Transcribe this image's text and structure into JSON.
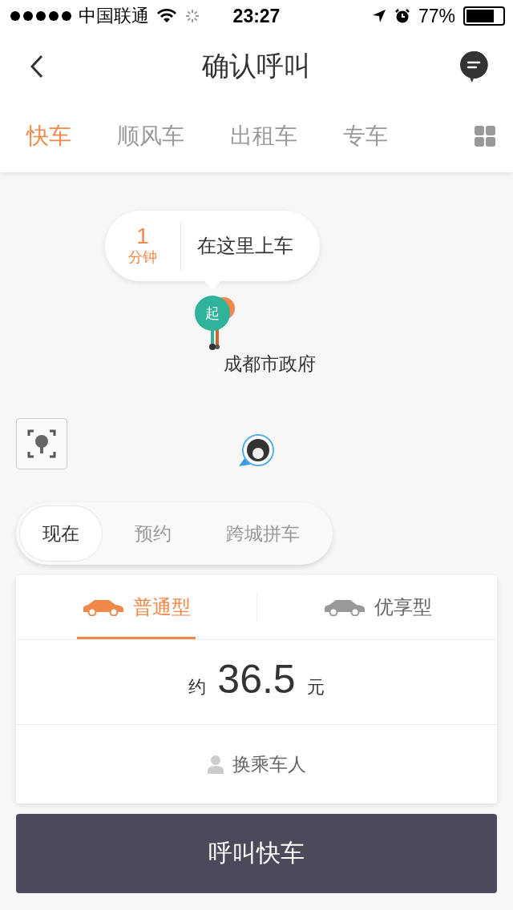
{
  "status_bar": {
    "carrier": "中国联通",
    "time": "23:27",
    "battery": "77%"
  },
  "nav": {
    "title": "确认呼叫"
  },
  "service_tabs": [
    {
      "label": "快车",
      "selected": true
    },
    {
      "label": "顺风车",
      "selected": false
    },
    {
      "label": "出租车",
      "selected": false
    },
    {
      "label": "专车",
      "selected": false
    }
  ],
  "map": {
    "eta_value": "1",
    "eta_unit": "分钟",
    "pickup_hint": "在这里上车",
    "start_marker": "起",
    "place_label": "成都市政府"
  },
  "time_modes": [
    {
      "label": "现在",
      "selected": true
    },
    {
      "label": "预约",
      "selected": false
    },
    {
      "label": "跨城拼车",
      "selected": false
    }
  ],
  "car_types": [
    {
      "label": "普通型",
      "selected": true
    },
    {
      "label": "优享型",
      "selected": false
    }
  ],
  "fare": {
    "prefix": "约",
    "amount": "36.5",
    "unit": "元"
  },
  "change_rider": "换乘车人",
  "call_button": "呼叫快车"
}
